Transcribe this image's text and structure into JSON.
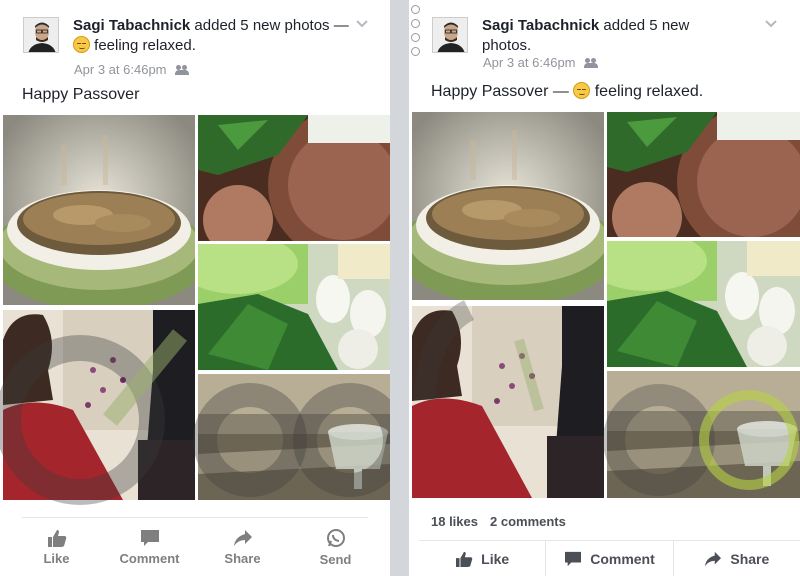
{
  "left_post": {
    "author": "Sagi Tabachnick",
    "action_text": " added 5 new photos — ",
    "feeling": " feeling relaxed.",
    "timestamp": "Apr 3 at 6:46pm",
    "status": "Happy Passover",
    "actions": [
      {
        "label": "Like",
        "icon": "thumbs-up-icon"
      },
      {
        "label": "Comment",
        "icon": "comment-icon"
      },
      {
        "label": "Share",
        "icon": "share-icon"
      },
      {
        "label": "Send",
        "icon": "whatsapp-icon"
      }
    ]
  },
  "right_post": {
    "author": "Sagi Tabachnick",
    "action_text": " added 5 new photos.",
    "timestamp": "Apr 3 at 6:46pm",
    "status_prefix": "Happy Passover — ",
    "feeling": " feeling relaxed.",
    "likes": "18 likes",
    "comments": "2 comments",
    "actions": [
      {
        "label": "Like",
        "icon": "thumbs-up-icon"
      },
      {
        "label": "Comment",
        "icon": "comment-icon"
      },
      {
        "label": "Share",
        "icon": "share-icon"
      }
    ]
  },
  "colors": {
    "background": "#d3d6db",
    "card": "#ffffff",
    "text": "#1d2129",
    "meta": "#90949c",
    "action": "#7f7f7f"
  }
}
